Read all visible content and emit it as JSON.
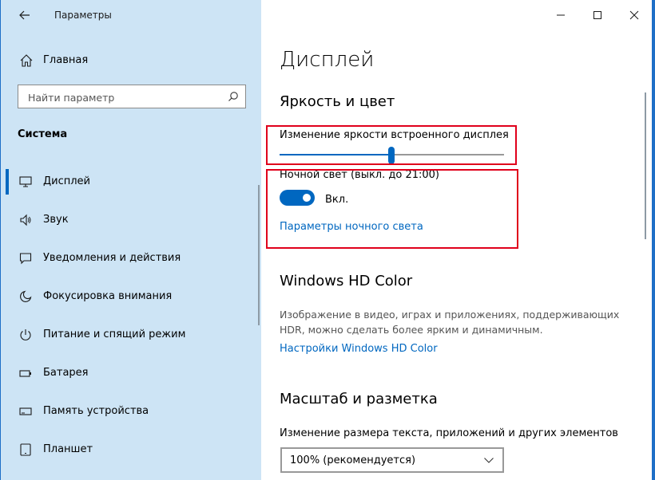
{
  "titlebar": {
    "app_title": "Параметры"
  },
  "sidebar": {
    "home_label": "Главная",
    "search_placeholder": "Найти параметр",
    "section_title": "Система",
    "items": [
      {
        "label": "Дисплей",
        "icon": "monitor-icon",
        "active": true
      },
      {
        "label": "Звук",
        "icon": "speaker-icon"
      },
      {
        "label": "Уведомления и действия",
        "icon": "notification-icon"
      },
      {
        "label": "Фокусировка внимания",
        "icon": "moon-icon"
      },
      {
        "label": "Питание и спящий режим",
        "icon": "power-icon"
      },
      {
        "label": "Батарея",
        "icon": "battery-icon"
      },
      {
        "label": "Память устройства",
        "icon": "storage-icon"
      },
      {
        "label": "Планшет",
        "icon": "tablet-icon"
      }
    ]
  },
  "main": {
    "page_title": "Дисплей",
    "brightness": {
      "heading": "Яркость и цвет",
      "slider_label": "Изменение яркости встроенного дисплея",
      "slider_value_fraction": 0.5
    },
    "night_light": {
      "label": "Ночной свет (выкл. до 21:00)",
      "toggle_state": "Вкл.",
      "settings_link": "Параметры ночного света"
    },
    "hd_color": {
      "heading": "Windows HD Color",
      "description": "Изображение в видео, играх и приложениях, поддерживающих HDR, можно сделать более ярким и динамичным.",
      "settings_link": "Настройки Windows HD Color"
    },
    "scale": {
      "heading": "Масштаб и разметка",
      "label": "Изменение размера текста, приложений и других элементов",
      "selected": "100% (рекомендуется)"
    }
  },
  "colors": {
    "accent": "#0067c0",
    "sidebar_bg": "#cde4f5",
    "highlight": "#e0001b"
  }
}
